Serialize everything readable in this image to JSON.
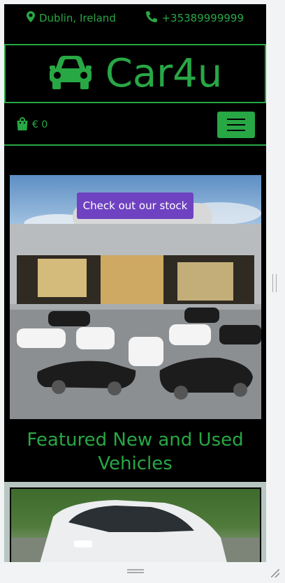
{
  "header": {
    "location": "Dublin, Ireland",
    "phone": "+35389999999"
  },
  "brand": {
    "name": "Car4u"
  },
  "nav": {
    "cart_amount": "€ 0"
  },
  "hero": {
    "cta_label": "Check out our stock"
  },
  "featured": {
    "title": "Featured New and Used Vehicles"
  },
  "colors": {
    "accent": "#28a745",
    "cta": "#6f42c1",
    "background": "#000000"
  },
  "icons": [
    "map-marker-icon",
    "phone-icon",
    "car-icon",
    "shopping-bag-icon",
    "hamburger-menu-icon"
  ]
}
